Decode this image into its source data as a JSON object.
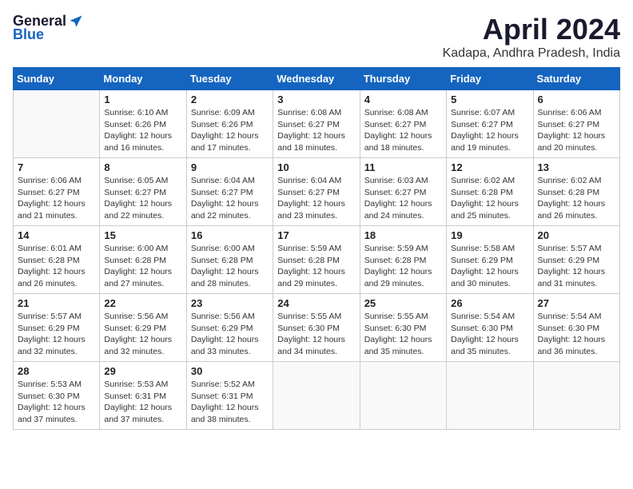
{
  "header": {
    "logo_general": "General",
    "logo_blue": "Blue",
    "month": "April 2024",
    "location": "Kadapa, Andhra Pradesh, India"
  },
  "weekdays": [
    "Sunday",
    "Monday",
    "Tuesday",
    "Wednesday",
    "Thursday",
    "Friday",
    "Saturday"
  ],
  "weeks": [
    [
      {
        "day": "",
        "sunrise": "",
        "sunset": "",
        "daylight": ""
      },
      {
        "day": "1",
        "sunrise": "Sunrise: 6:10 AM",
        "sunset": "Sunset: 6:26 PM",
        "daylight": "Daylight: 12 hours and 16 minutes."
      },
      {
        "day": "2",
        "sunrise": "Sunrise: 6:09 AM",
        "sunset": "Sunset: 6:26 PM",
        "daylight": "Daylight: 12 hours and 17 minutes."
      },
      {
        "day": "3",
        "sunrise": "Sunrise: 6:08 AM",
        "sunset": "Sunset: 6:27 PM",
        "daylight": "Daylight: 12 hours and 18 minutes."
      },
      {
        "day": "4",
        "sunrise": "Sunrise: 6:08 AM",
        "sunset": "Sunset: 6:27 PM",
        "daylight": "Daylight: 12 hours and 18 minutes."
      },
      {
        "day": "5",
        "sunrise": "Sunrise: 6:07 AM",
        "sunset": "Sunset: 6:27 PM",
        "daylight": "Daylight: 12 hours and 19 minutes."
      },
      {
        "day": "6",
        "sunrise": "Sunrise: 6:06 AM",
        "sunset": "Sunset: 6:27 PM",
        "daylight": "Daylight: 12 hours and 20 minutes."
      }
    ],
    [
      {
        "day": "7",
        "sunrise": "Sunrise: 6:06 AM",
        "sunset": "Sunset: 6:27 PM",
        "daylight": "Daylight: 12 hours and 21 minutes."
      },
      {
        "day": "8",
        "sunrise": "Sunrise: 6:05 AM",
        "sunset": "Sunset: 6:27 PM",
        "daylight": "Daylight: 12 hours and 22 minutes."
      },
      {
        "day": "9",
        "sunrise": "Sunrise: 6:04 AM",
        "sunset": "Sunset: 6:27 PM",
        "daylight": "Daylight: 12 hours and 22 minutes."
      },
      {
        "day": "10",
        "sunrise": "Sunrise: 6:04 AM",
        "sunset": "Sunset: 6:27 PM",
        "daylight": "Daylight: 12 hours and 23 minutes."
      },
      {
        "day": "11",
        "sunrise": "Sunrise: 6:03 AM",
        "sunset": "Sunset: 6:27 PM",
        "daylight": "Daylight: 12 hours and 24 minutes."
      },
      {
        "day": "12",
        "sunrise": "Sunrise: 6:02 AM",
        "sunset": "Sunset: 6:28 PM",
        "daylight": "Daylight: 12 hours and 25 minutes."
      },
      {
        "day": "13",
        "sunrise": "Sunrise: 6:02 AM",
        "sunset": "Sunset: 6:28 PM",
        "daylight": "Daylight: 12 hours and 26 minutes."
      }
    ],
    [
      {
        "day": "14",
        "sunrise": "Sunrise: 6:01 AM",
        "sunset": "Sunset: 6:28 PM",
        "daylight": "Daylight: 12 hours and 26 minutes."
      },
      {
        "day": "15",
        "sunrise": "Sunrise: 6:00 AM",
        "sunset": "Sunset: 6:28 PM",
        "daylight": "Daylight: 12 hours and 27 minutes."
      },
      {
        "day": "16",
        "sunrise": "Sunrise: 6:00 AM",
        "sunset": "Sunset: 6:28 PM",
        "daylight": "Daylight: 12 hours and 28 minutes."
      },
      {
        "day": "17",
        "sunrise": "Sunrise: 5:59 AM",
        "sunset": "Sunset: 6:28 PM",
        "daylight": "Daylight: 12 hours and 29 minutes."
      },
      {
        "day": "18",
        "sunrise": "Sunrise: 5:59 AM",
        "sunset": "Sunset: 6:28 PM",
        "daylight": "Daylight: 12 hours and 29 minutes."
      },
      {
        "day": "19",
        "sunrise": "Sunrise: 5:58 AM",
        "sunset": "Sunset: 6:29 PM",
        "daylight": "Daylight: 12 hours and 30 minutes."
      },
      {
        "day": "20",
        "sunrise": "Sunrise: 5:57 AM",
        "sunset": "Sunset: 6:29 PM",
        "daylight": "Daylight: 12 hours and 31 minutes."
      }
    ],
    [
      {
        "day": "21",
        "sunrise": "Sunrise: 5:57 AM",
        "sunset": "Sunset: 6:29 PM",
        "daylight": "Daylight: 12 hours and 32 minutes."
      },
      {
        "day": "22",
        "sunrise": "Sunrise: 5:56 AM",
        "sunset": "Sunset: 6:29 PM",
        "daylight": "Daylight: 12 hours and 32 minutes."
      },
      {
        "day": "23",
        "sunrise": "Sunrise: 5:56 AM",
        "sunset": "Sunset: 6:29 PM",
        "daylight": "Daylight: 12 hours and 33 minutes."
      },
      {
        "day": "24",
        "sunrise": "Sunrise: 5:55 AM",
        "sunset": "Sunset: 6:30 PM",
        "daylight": "Daylight: 12 hours and 34 minutes."
      },
      {
        "day": "25",
        "sunrise": "Sunrise: 5:55 AM",
        "sunset": "Sunset: 6:30 PM",
        "daylight": "Daylight: 12 hours and 35 minutes."
      },
      {
        "day": "26",
        "sunrise": "Sunrise: 5:54 AM",
        "sunset": "Sunset: 6:30 PM",
        "daylight": "Daylight: 12 hours and 35 minutes."
      },
      {
        "day": "27",
        "sunrise": "Sunrise: 5:54 AM",
        "sunset": "Sunset: 6:30 PM",
        "daylight": "Daylight: 12 hours and 36 minutes."
      }
    ],
    [
      {
        "day": "28",
        "sunrise": "Sunrise: 5:53 AM",
        "sunset": "Sunset: 6:30 PM",
        "daylight": "Daylight: 12 hours and 37 minutes."
      },
      {
        "day": "29",
        "sunrise": "Sunrise: 5:53 AM",
        "sunset": "Sunset: 6:31 PM",
        "daylight": "Daylight: 12 hours and 37 minutes."
      },
      {
        "day": "30",
        "sunrise": "Sunrise: 5:52 AM",
        "sunset": "Sunset: 6:31 PM",
        "daylight": "Daylight: 12 hours and 38 minutes."
      },
      {
        "day": "",
        "sunrise": "",
        "sunset": "",
        "daylight": ""
      },
      {
        "day": "",
        "sunrise": "",
        "sunset": "",
        "daylight": ""
      },
      {
        "day": "",
        "sunrise": "",
        "sunset": "",
        "daylight": ""
      },
      {
        "day": "",
        "sunrise": "",
        "sunset": "",
        "daylight": ""
      }
    ]
  ]
}
